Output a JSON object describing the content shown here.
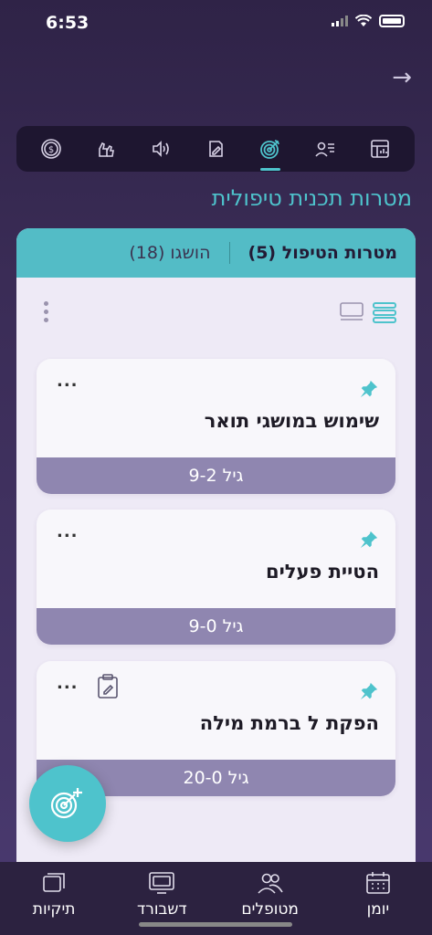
{
  "status": {
    "time": "6:53"
  },
  "toolbar": {
    "items": [
      {
        "icon": "dollar-coin-icon"
      },
      {
        "icon": "hands-icon"
      },
      {
        "icon": "speaker-icon"
      },
      {
        "icon": "edit-document-icon"
      },
      {
        "icon": "target-icon",
        "active": true
      },
      {
        "icon": "person-list-icon"
      },
      {
        "icon": "dashboard-chart-icon"
      }
    ]
  },
  "page": {
    "title": "מטרות תכנית טיפולית"
  },
  "tabs": {
    "active": "מטרות הטיפול (5)",
    "inactive": "הושגו (18)"
  },
  "cards": [
    {
      "title": "שימוש במושגי תואר",
      "age": "גיל 9-2",
      "more": "...",
      "has_clipboard": false
    },
    {
      "title": "הטיית פעלים",
      "age": "גיל 9-0",
      "more": "...",
      "has_clipboard": false
    },
    {
      "title": "הפקת ל ברמת מילה",
      "age": "גיל 20-0",
      "more": "...",
      "has_clipboard": true
    }
  ],
  "nav": {
    "items": [
      {
        "label": "תיקיות",
        "icon": "folders-icon"
      },
      {
        "label": "דשבורד",
        "icon": "dashboard-icon"
      },
      {
        "label": "מטופלים",
        "icon": "patients-icon"
      },
      {
        "label": "יומן",
        "icon": "calendar-icon"
      }
    ]
  },
  "colors": {
    "accent": "#4ec3cc",
    "footer": "#8f86b0",
    "background": "#3a2c56"
  }
}
